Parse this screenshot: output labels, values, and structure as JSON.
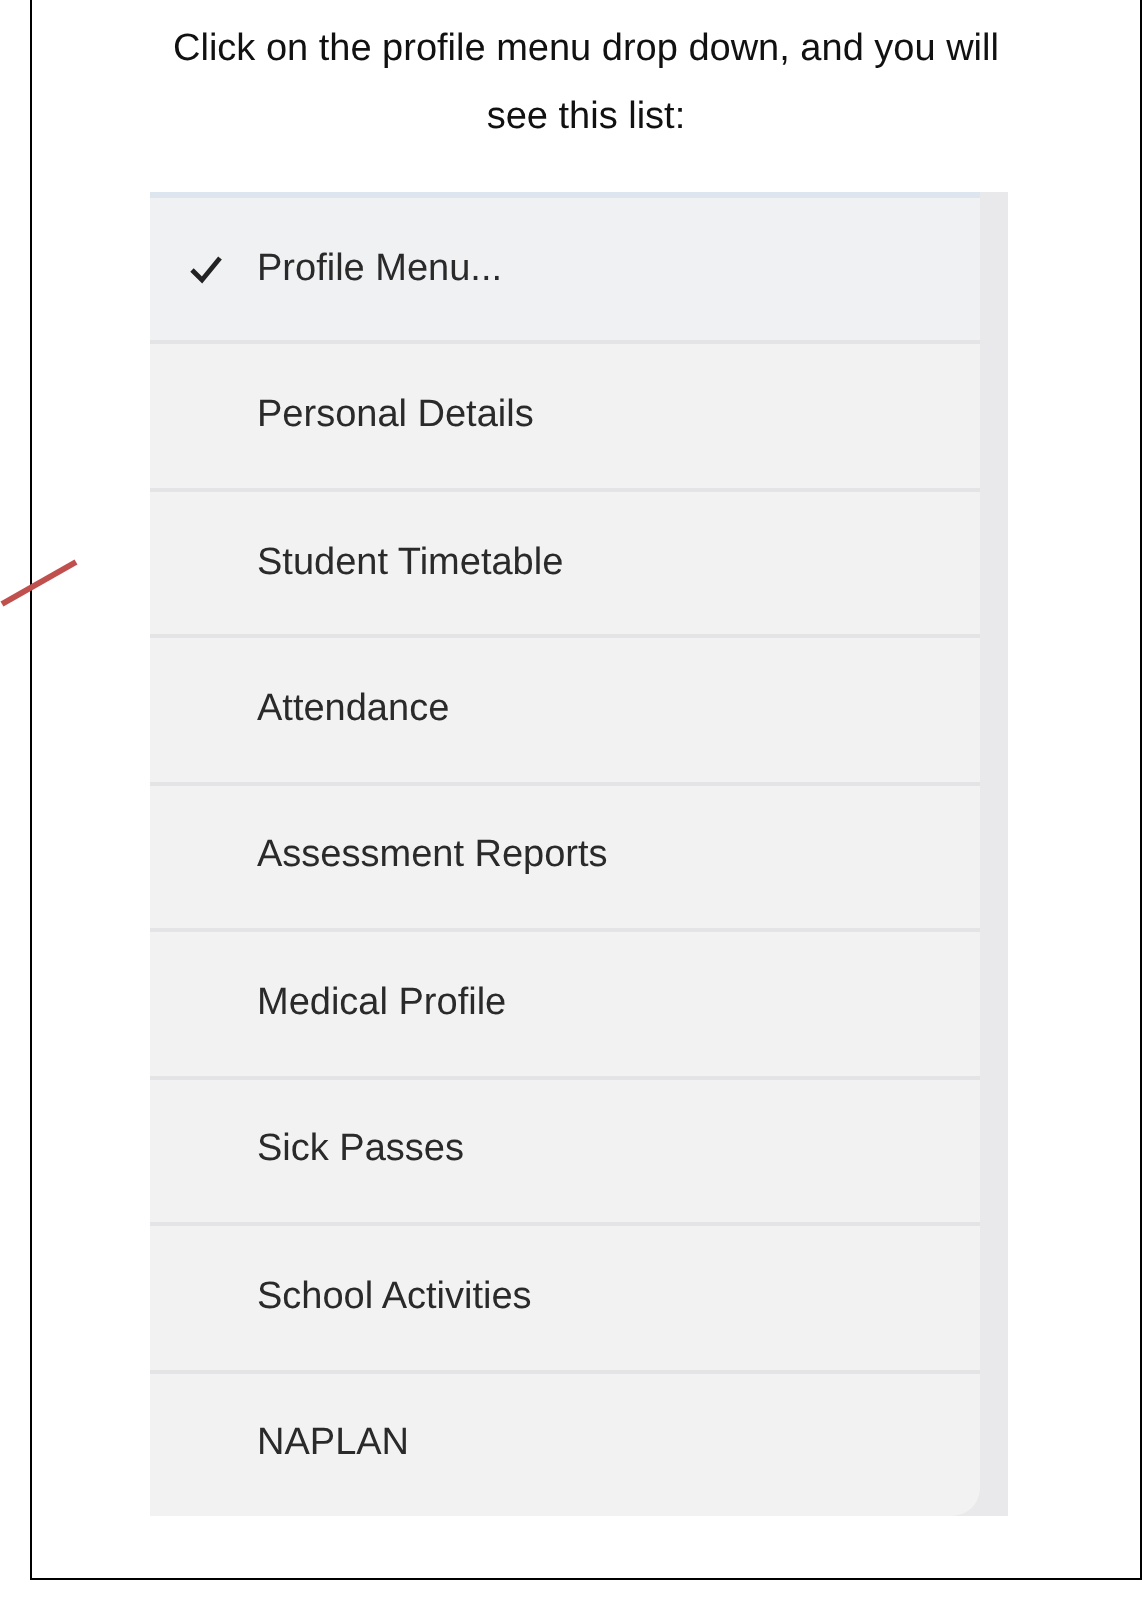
{
  "caption": "Click on the profile menu drop down, and you will see this list:",
  "menu": {
    "items": [
      {
        "label": "Profile Menu...",
        "checked": true
      },
      {
        "label": "Personal Details",
        "checked": false
      },
      {
        "label": "Student Timetable",
        "checked": false
      },
      {
        "label": "Attendance",
        "checked": false
      },
      {
        "label": "Assessment Reports",
        "checked": false
      },
      {
        "label": "Medical Profile",
        "checked": false
      },
      {
        "label": "Sick Passes",
        "checked": false
      },
      {
        "label": "School Activities",
        "checked": false
      },
      {
        "label": "NAPLAN",
        "checked": false
      }
    ]
  }
}
